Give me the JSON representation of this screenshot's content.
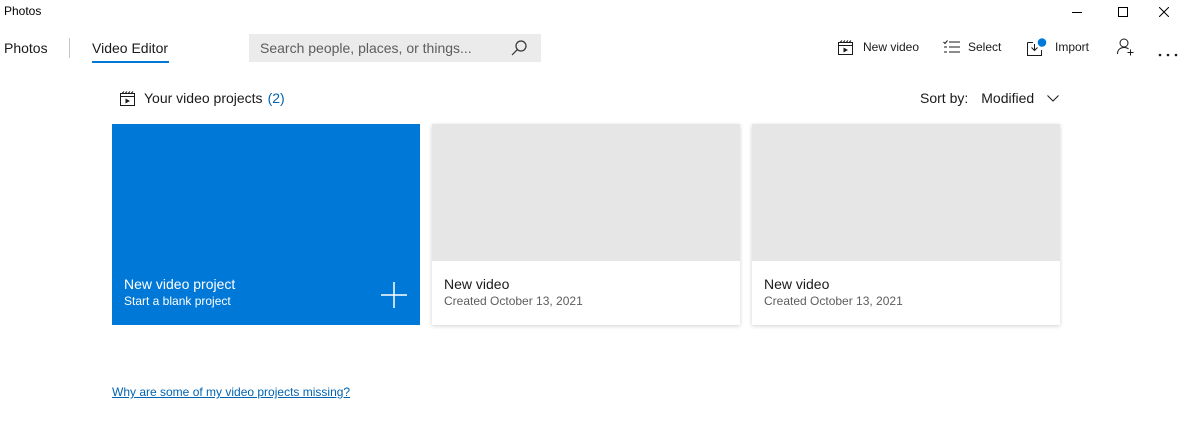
{
  "app": {
    "title": "Photos"
  },
  "nav": {
    "tabs": [
      {
        "label": "Photos"
      },
      {
        "label": "Video Editor"
      }
    ]
  },
  "search": {
    "placeholder": "Search people, places, or things..."
  },
  "toolbar": {
    "new_video_label": "New video",
    "select_label": "Select",
    "import_label": "Import"
  },
  "section": {
    "title": "Your video projects",
    "count": "(2)",
    "sort_label": "Sort by:",
    "sort_value": "Modified"
  },
  "new_project": {
    "title": "New video project",
    "subtitle": "Start a blank project"
  },
  "projects": [
    {
      "title": "New video",
      "created": "Created October 13, 2021"
    },
    {
      "title": "New video",
      "created": "Created October 13, 2021"
    }
  ],
  "footer": {
    "missing_link": "Why are some of my video projects missing?"
  },
  "colors": {
    "accent": "#0078d7",
    "link": "#0063b1",
    "thumb": "#e6e6e6"
  }
}
